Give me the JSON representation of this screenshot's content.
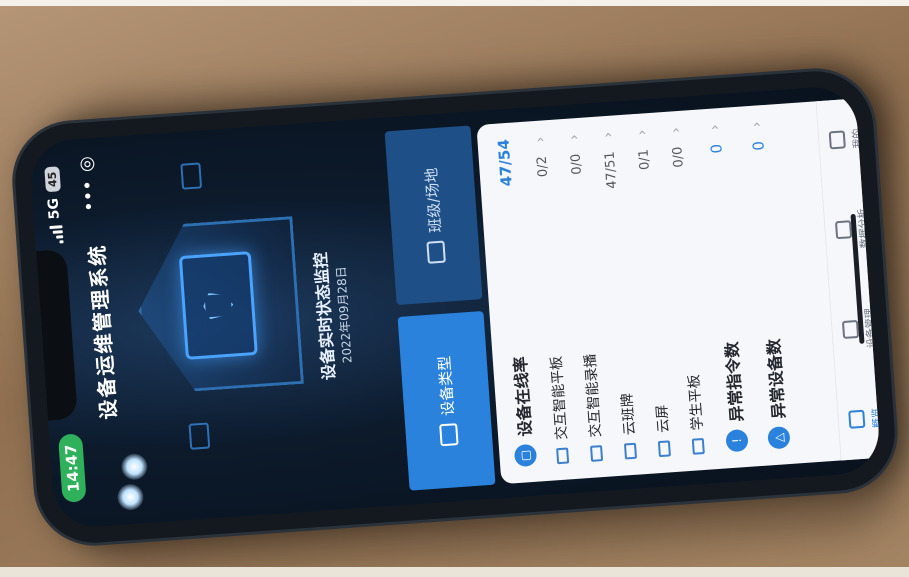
{
  "status_bar": {
    "time": "14:47",
    "network": "5G",
    "battery": "45"
  },
  "app": {
    "title": "设备运维管理系统"
  },
  "hero": {
    "title": "设备实时状态监控",
    "date": "2022年09月28日"
  },
  "tabs": [
    {
      "label": "设备类型",
      "active": true
    },
    {
      "label": "班级/场地",
      "active": false
    }
  ],
  "sections": {
    "online": {
      "title": "设备在线率",
      "value": "47/54",
      "rows": [
        {
          "label": "交互智能平板",
          "value": "0/2"
        },
        {
          "label": "交互智能录播",
          "value": "0/0"
        },
        {
          "label": "云班牌",
          "value": "47/51"
        },
        {
          "label": "云屏",
          "value": "0/1"
        },
        {
          "label": "学生平板",
          "value": "0/0"
        }
      ]
    },
    "abnormal_cmd": {
      "title": "异常指令数",
      "value": "0"
    },
    "abnormal_dev": {
      "title": "异常设备数",
      "value": "0"
    }
  },
  "tabbar": [
    {
      "label": "概览",
      "icon": "home-icon",
      "active": true
    },
    {
      "label": "设备管理",
      "icon": "device-manage-icon",
      "active": false
    },
    {
      "label": "数据分析",
      "icon": "chart-icon",
      "active": false
    },
    {
      "label": "我的",
      "icon": "user-icon",
      "active": false
    }
  ],
  "colors": {
    "accent": "#2a82dd",
    "time_pill": "#2fb15b",
    "screen_bg": "#0c1a2b"
  }
}
